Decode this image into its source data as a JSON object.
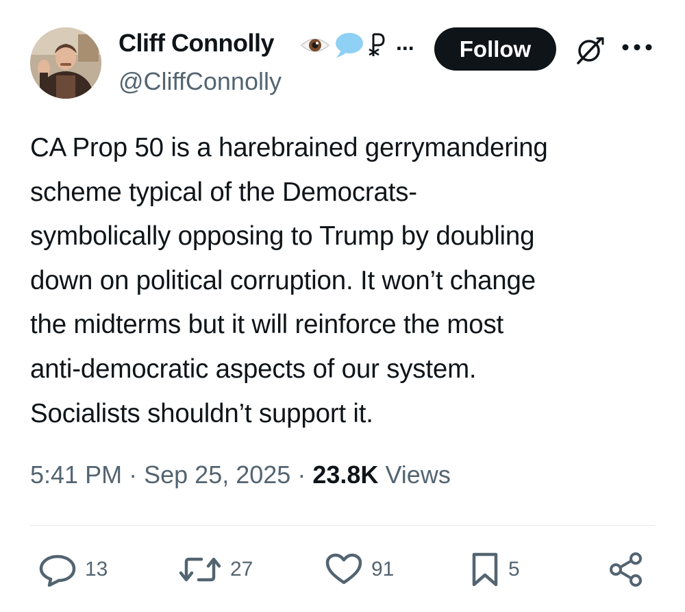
{
  "author": {
    "name": "Cliff Connolly",
    "handle": "@CliffConnolly",
    "name_emojis": [
      "eye-emoji",
      "speech-bubble-emoji",
      "chi-rho-symbol"
    ],
    "name_overflow": "..."
  },
  "follow_label": "Follow",
  "tweet_lines": [
    "CA Prop 50 is a harebrained gerrymandering",
    "scheme typical of the Democrats-",
    "symbolically opposing to Trump by doubling",
    "down on political corruption. It won’t change",
    "the midterms but it will reinforce the most",
    "anti-democratic aspects of our system.",
    "Socialists shouldn’t support it."
  ],
  "meta": {
    "time": "5:41 PM",
    "separator": "·",
    "date": "Sep 25, 2025",
    "views_count": "23.8K",
    "views_label": "Views"
  },
  "actions": {
    "replies": "13",
    "reposts": "27",
    "likes": "91",
    "bookmarks": "5"
  },
  "colors": {
    "text": "#0f1419",
    "secondary": "#536471",
    "button": "#0f1419",
    "divider": "#e6e9eb",
    "emoji_bubble": "#8fd0f5"
  }
}
